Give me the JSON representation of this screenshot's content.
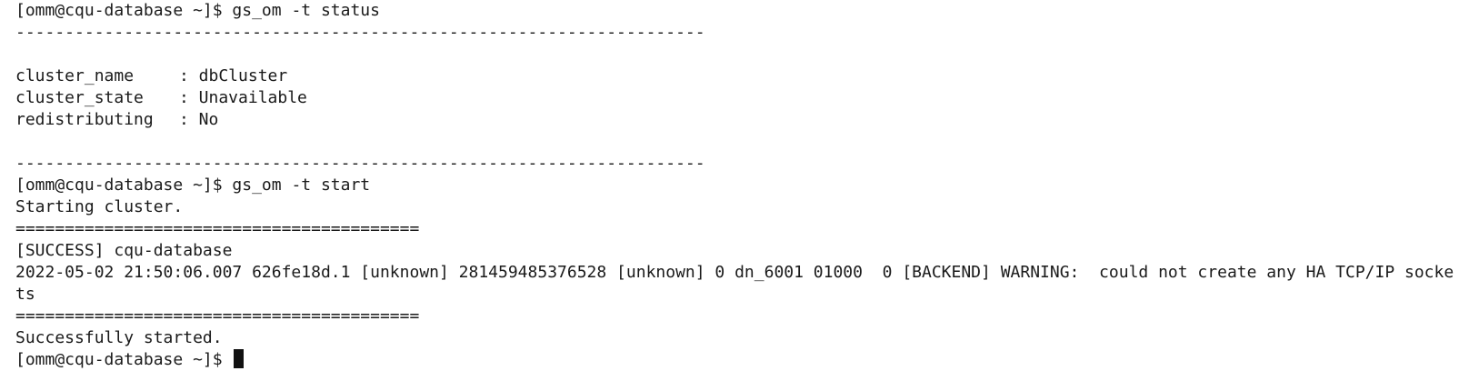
{
  "terminal": {
    "status_command": {
      "prompt": "[omm@cqu-database ~]$ ",
      "command": "gs_om -t status"
    },
    "separator_dash": "----------------------------------------------------------------------",
    "status_fields": [
      {
        "key": "cluster_name",
        "value": ": dbCluster"
      },
      {
        "key": "cluster_state",
        "value": ": Unavailable"
      },
      {
        "key": "redistributing",
        "value": ": No"
      }
    ],
    "start_command": {
      "prompt": "[omm@cqu-database ~]$ ",
      "command": "gs_om -t start"
    },
    "starting_text": "Starting cluster.",
    "separator_equals": "=========================================",
    "success_line": "[SUCCESS] cqu-database",
    "warning_line_1": "2022-05-02 21:50:06.007 626fe18d.1 [unknown] 281459485376528 [unknown] 0 dn_6001 01000  0 [BACKEND] WARNING:  could not create any HA TCP/IP socke",
    "warning_line_2": "ts",
    "started_text": "Successfully started.",
    "final_prompt": "[omm@cqu-database ~]$ "
  }
}
